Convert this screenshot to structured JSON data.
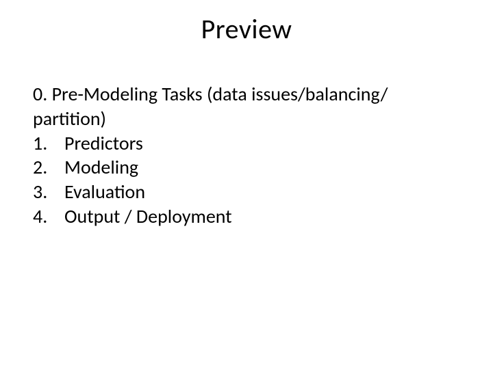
{
  "title": "Preview",
  "lead": "0. Pre-Modeling Tasks (data issues/balancing/ partition)",
  "items": [
    {
      "num": "1.",
      "text": "Predictors"
    },
    {
      "num": "2.",
      "text": "Modeling"
    },
    {
      "num": "3.",
      "text": "Evaluation"
    },
    {
      "num": "4.",
      "text": "Output / Deployment"
    }
  ]
}
